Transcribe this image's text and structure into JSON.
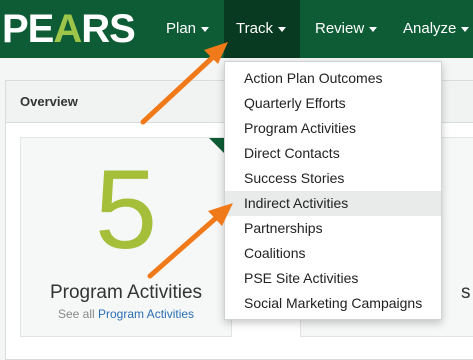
{
  "app": {
    "logo_text_a": "PE",
    "logo_text_b": "A",
    "logo_text_c": "RS"
  },
  "nav": {
    "items": [
      {
        "label": "Plan"
      },
      {
        "label": "Track"
      },
      {
        "label": "Review"
      },
      {
        "label": "Analyze"
      }
    ],
    "active": "Track"
  },
  "overview": {
    "title": "Overview",
    "card": {
      "number": "5",
      "label": "Program Activities",
      "see_all_prefix": "See all",
      "see_all_link": "Program Activities"
    },
    "card2": {
      "label": "s"
    }
  },
  "dropdown": {
    "items": [
      {
        "label": "Action Plan Outcomes"
      },
      {
        "label": "Quarterly Efforts"
      },
      {
        "label": "Program Activities"
      },
      {
        "label": "Direct Contacts"
      },
      {
        "label": "Success Stories"
      },
      {
        "label": "Indirect Activities"
      },
      {
        "label": "Partnerships"
      },
      {
        "label": "Coalitions"
      },
      {
        "label": "PSE Site Activities"
      },
      {
        "label": "Social Marketing Campaigns"
      }
    ],
    "highlighted": "Indirect Activities"
  },
  "colors": {
    "nav_bg": "#0e5c35",
    "nav_active_bg": "#073a20",
    "accent_number": "#a6bf3a",
    "arrow": "#f07a1a",
    "link": "#2a6fb5"
  },
  "icons": [
    "caret-down-icon",
    "pointer-arrow-icon"
  ]
}
